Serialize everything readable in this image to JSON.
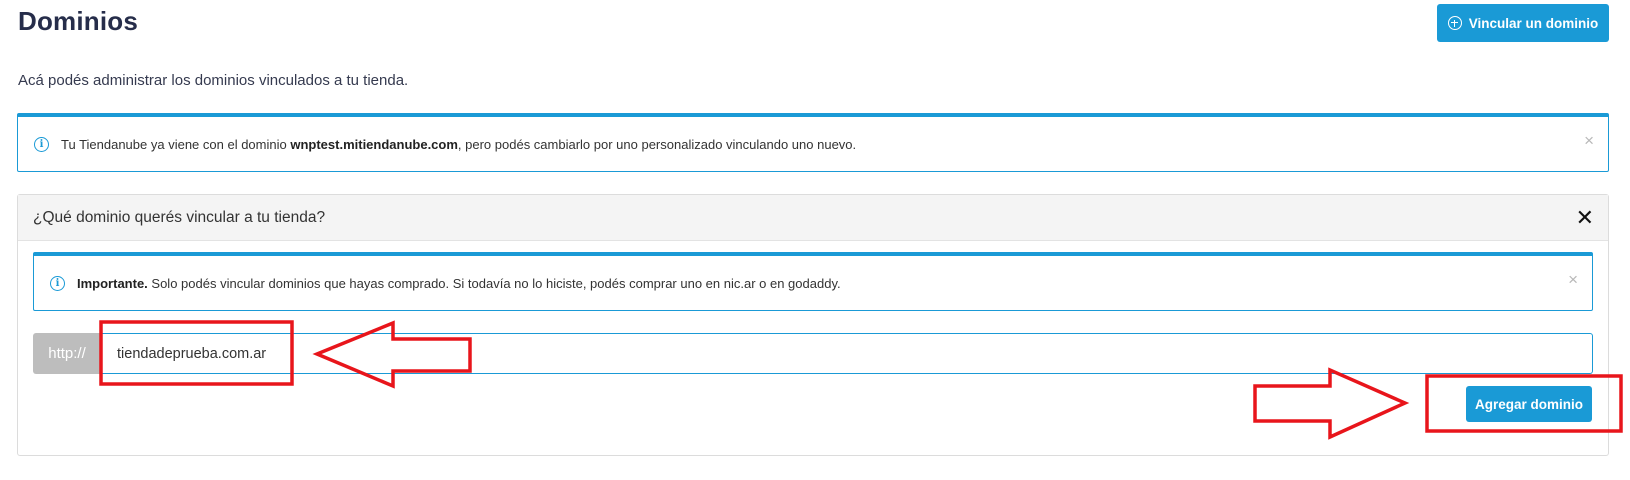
{
  "page": {
    "title": "Dominios",
    "subtitle": "Acá podés administrar los dominios vinculados a tu tienda.",
    "link_domain_button": "Vincular un dominio"
  },
  "info_alert": {
    "text_before": "Tu Tiendanube ya viene con el dominio ",
    "domain": "wnptest.mitiendanube.com",
    "text_after": ", pero podés cambiarlo por uno personalizado vinculando uno nuevo.",
    "close": "×"
  },
  "link_panel": {
    "heading": "¿Qué dominio querés vincular a tu tienda?",
    "close": "✕",
    "important_alert": {
      "label": "Importante.",
      "text": " Solo podés vincular dominios que hayas comprado. Si todavía no lo hiciste, podés comprar uno en nic.ar o en godaddy.",
      "close": "×"
    },
    "prefix": "http://",
    "domain_input_value": "tiendadeprueba.com.ar",
    "add_button": "Agregar dominio"
  },
  "colors": {
    "accent": "#1a9ad6",
    "annotation": "#e8151b",
    "title": "#262d4a"
  }
}
